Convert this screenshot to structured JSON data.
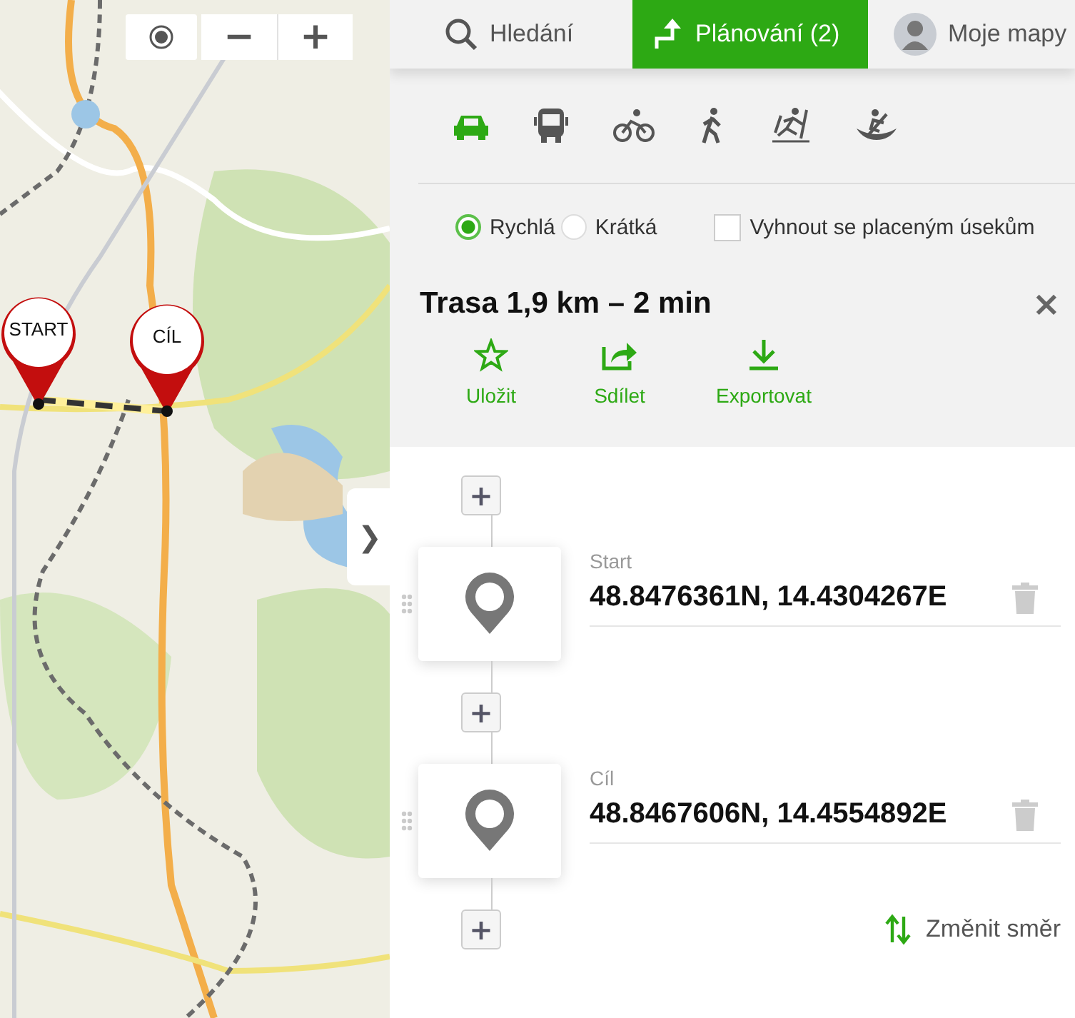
{
  "map": {
    "kind": "picture",
    "zoom_out": "−",
    "zoom_in": "+",
    "collapse": "❯",
    "markers": [
      {
        "label": "START",
        "kind": "start"
      },
      {
        "label": "CÍL",
        "kind": "end"
      }
    ]
  },
  "tabs": [
    {
      "label": "Hledání",
      "selected": false
    },
    {
      "label": "Plánování (2)",
      "selected": true
    },
    {
      "label": "Moje mapy",
      "selected": false
    }
  ],
  "transport_modes": [
    {
      "kind": "car",
      "selected": true
    },
    {
      "kind": "bus",
      "selected": false
    },
    {
      "kind": "bike",
      "selected": false
    },
    {
      "kind": "walk",
      "selected": false
    },
    {
      "kind": "ski",
      "selected": false
    },
    {
      "kind": "boat",
      "selected": false
    }
  ],
  "route_types": [
    {
      "label": "Rychlá",
      "selected": true
    },
    {
      "label": "Krátká",
      "selected": false
    }
  ],
  "avoid_tolls": {
    "label": "Vyhnout se placeným úsekům",
    "checked": false
  },
  "route": {
    "title": "Trasa 1,9 km – 2 min",
    "close": "×",
    "actions": [
      {
        "kind": "star",
        "label": "Uložit"
      },
      {
        "kind": "share",
        "label": "Sdílet"
      },
      {
        "kind": "download",
        "label": "Exportovat"
      }
    ]
  },
  "add_stop": "+",
  "waypoints": [
    {
      "label": "Start",
      "value": "48.8476361N, 14.4304267E"
    },
    {
      "label": "Cíl",
      "value": "48.8467606N, 14.4554892E"
    }
  ],
  "reverse": "Změnit směr"
}
